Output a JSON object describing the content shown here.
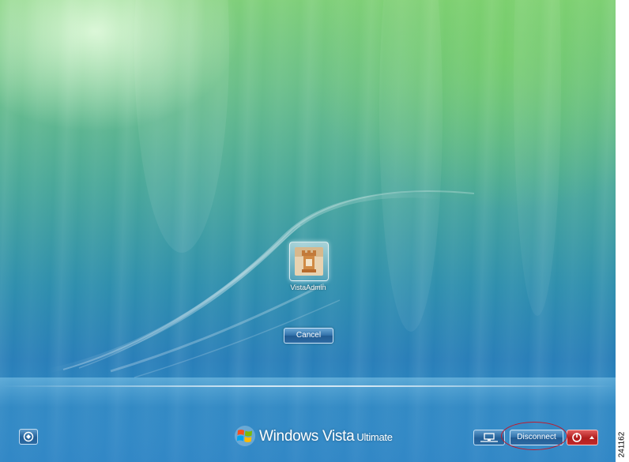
{
  "login_screen": {
    "user": {
      "name": "VistaAdmin",
      "avatar_icon": "chess-rook-picture-icon"
    },
    "cancel_label": "Cancel",
    "brand": {
      "name": "Windows Vista",
      "edition": "Ultimate"
    },
    "bottom_bar": {
      "ease_of_access_icon": "ease-of-access-icon",
      "network_icon": "network-icon",
      "disconnect_label": "Disconnect",
      "power_icon": "power-icon",
      "power_menu_icon": "chevron-up-icon"
    }
  },
  "figure_number": "241162",
  "colors": {
    "annotation_ring": "#c0182b",
    "button_blue": "#2f6fa8",
    "power_red": "#b01e1e",
    "sky_green": "#7fcf7a",
    "sky_blue": "#2b86c0"
  }
}
